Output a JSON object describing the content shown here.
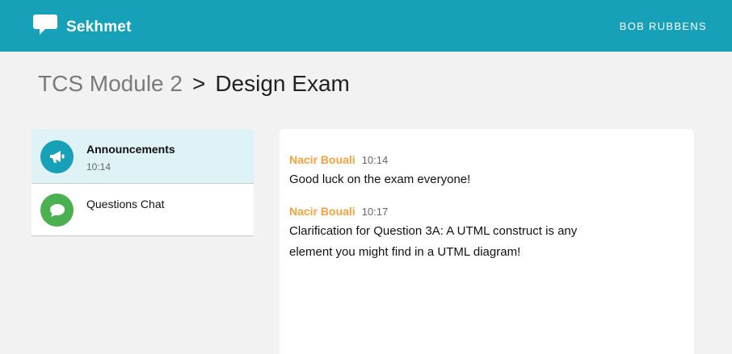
{
  "header": {
    "app_name": "Sekhmet",
    "logo_icon": "speech-bubble-icon",
    "user_name": "BOB RUBBENS",
    "bar_color": "#17a1b8"
  },
  "breadcrumb": {
    "parent": "TCS Module 2",
    "separator": ">",
    "current": "Design Exam"
  },
  "channels": [
    {
      "name": "Announcements",
      "time": "10:14",
      "icon": "megaphone-icon",
      "color": "#17a1b8",
      "active": true
    },
    {
      "name": "Questions Chat",
      "time": "",
      "icon": "chat-bubble-icon",
      "color": "#4bb04f",
      "active": false
    }
  ],
  "messages": [
    {
      "author": "Nacir Bouali",
      "time": "10:14",
      "text": "Good luck on the exam everyone!"
    },
    {
      "author": "Nacir Bouali",
      "time": "10:17",
      "text": "Clarification for Question 3A: A UTML construct is any element you might find in a UTML diagram!"
    }
  ],
  "colors": {
    "author": "#f0a340",
    "active_channel_bg": "#dff2f6"
  }
}
